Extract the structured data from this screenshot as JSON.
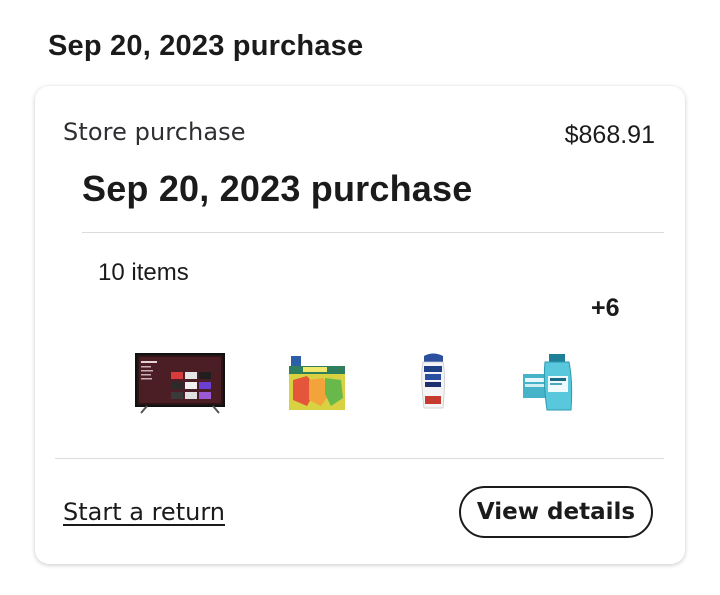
{
  "page": {
    "title": "Sep 20, 2023 purchase"
  },
  "card": {
    "store_label": "Store purchase",
    "total": "$868.91",
    "inner_title": "Sep 20, 2023 purchase",
    "item_count": "10 items",
    "more_count": "+6",
    "thumbnails": [
      {
        "icon": "tv-product-icon"
      },
      {
        "icon": "snack-box-product-icon"
      },
      {
        "icon": "shampoo-bottle-product-icon"
      },
      {
        "icon": "mouthwash-product-icon"
      }
    ],
    "start_return_label": "Start a return",
    "view_details_label": "View details"
  }
}
